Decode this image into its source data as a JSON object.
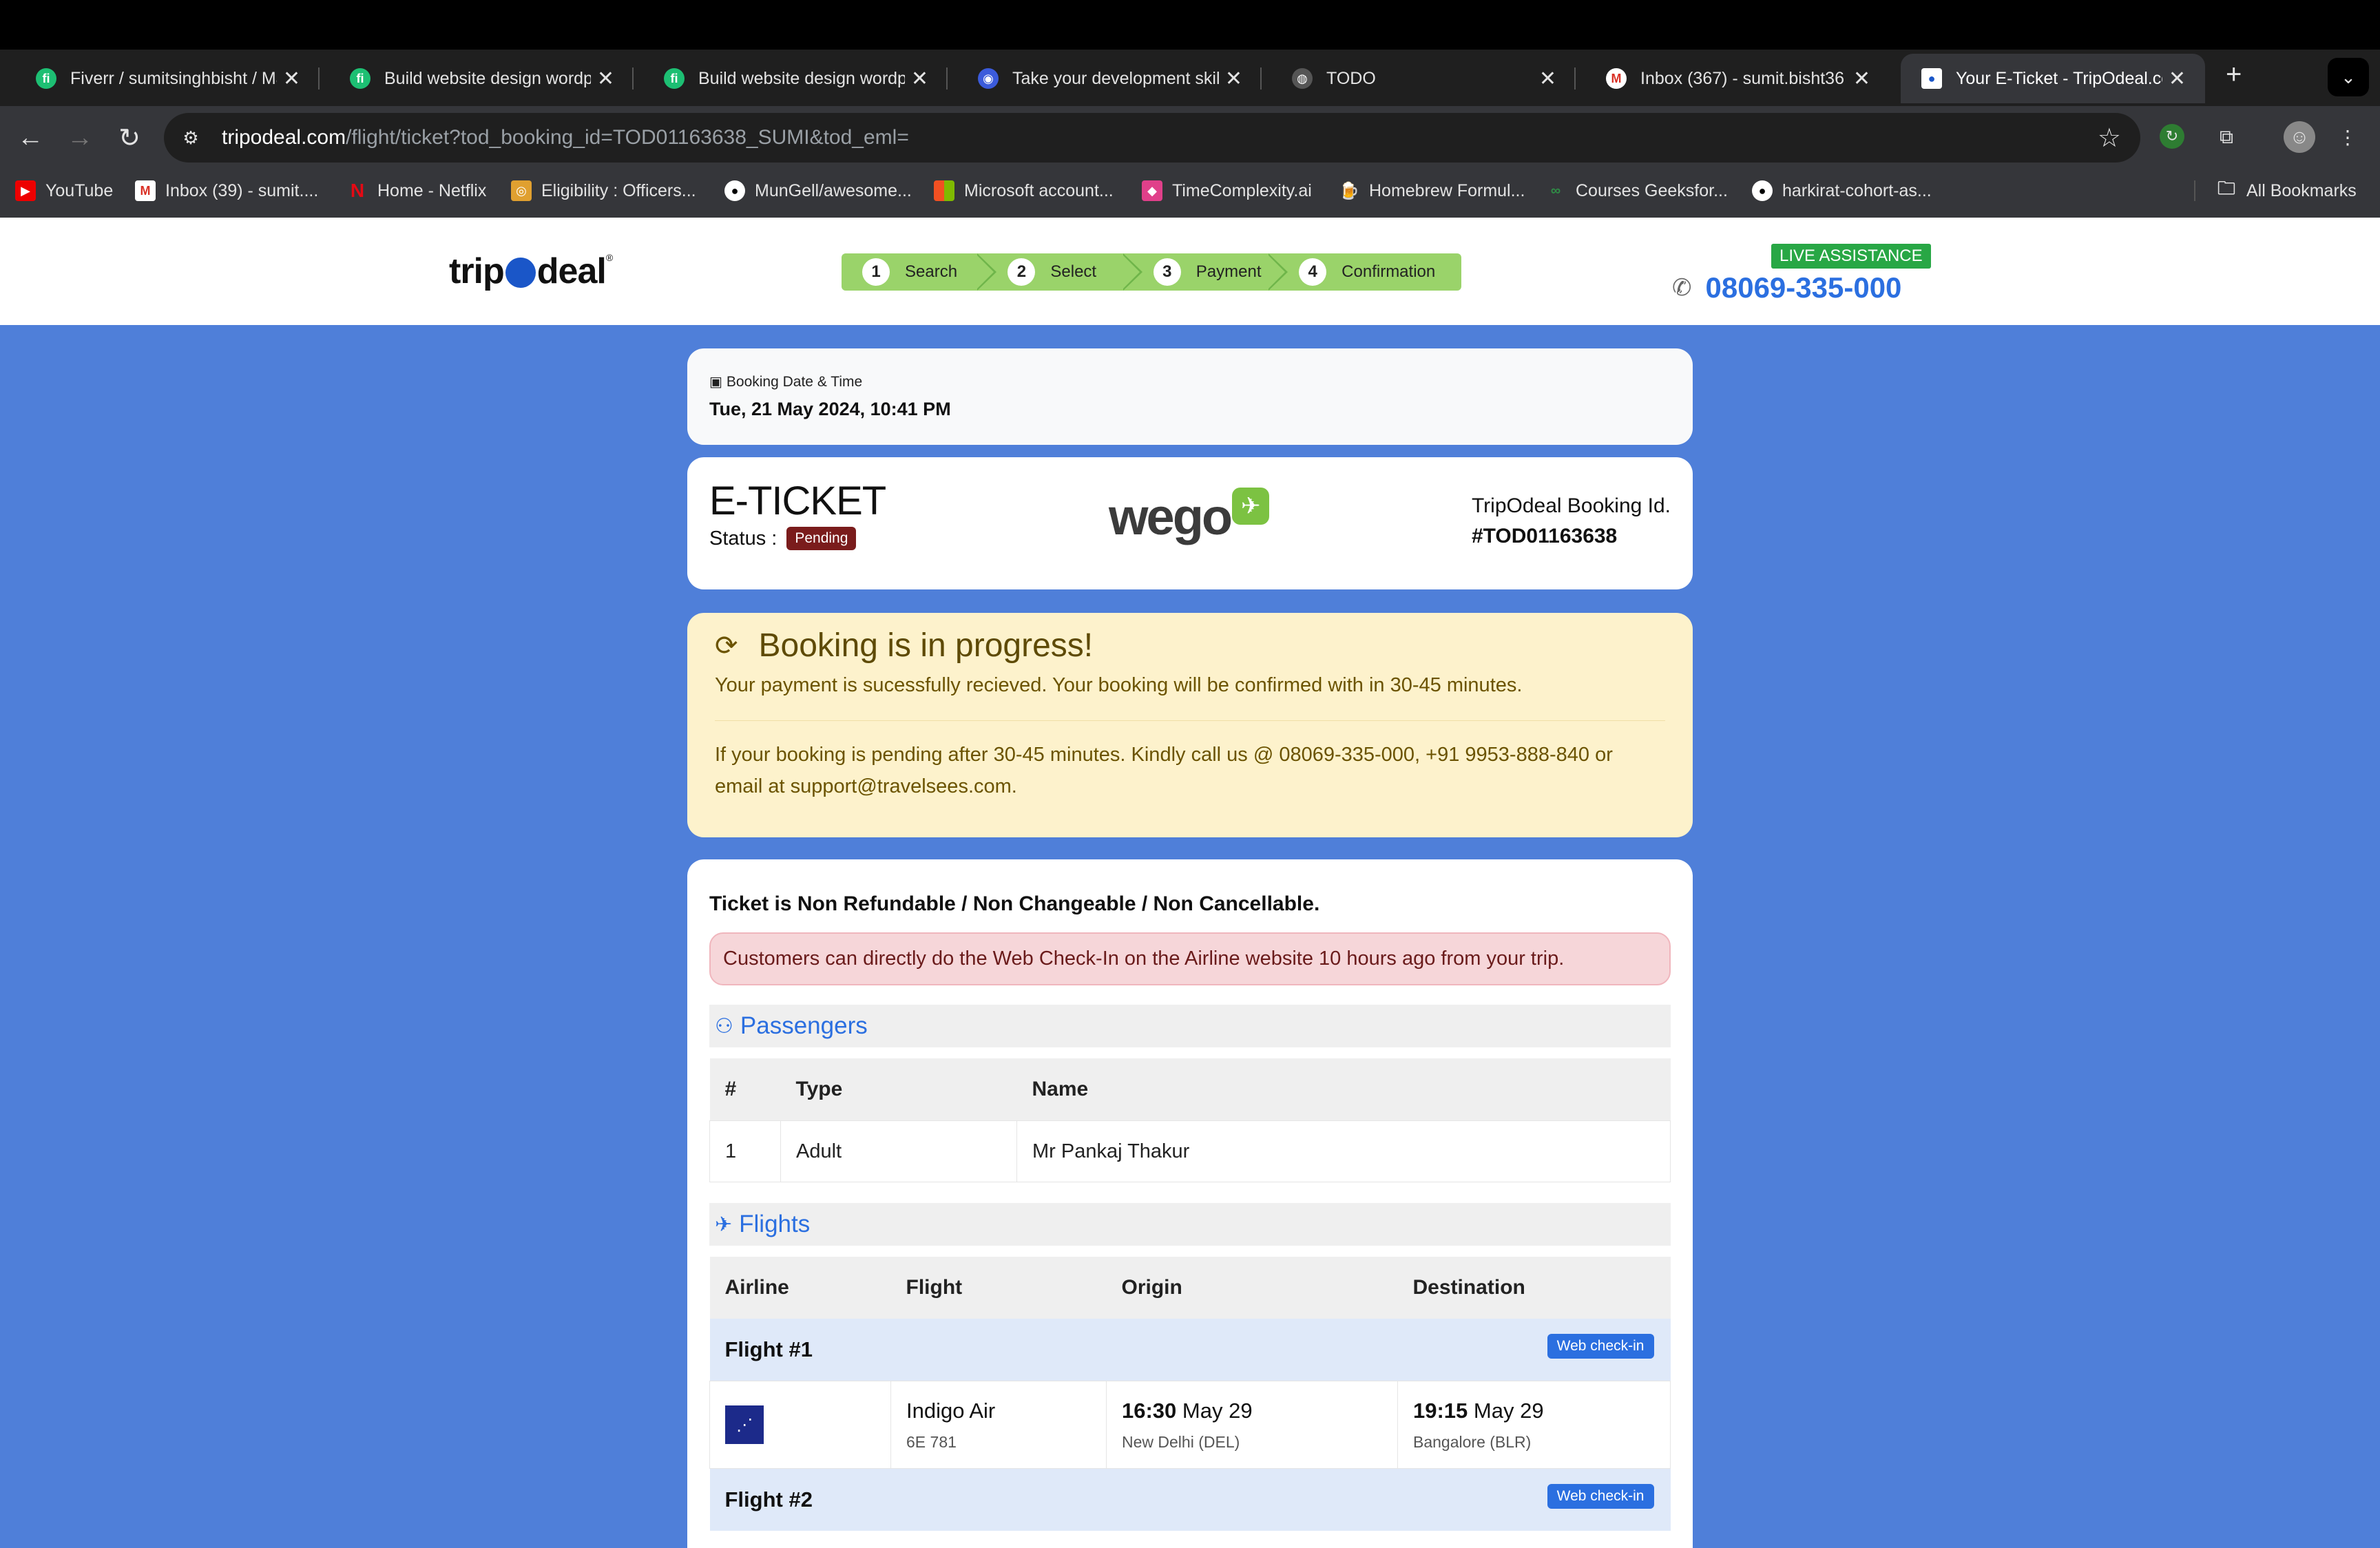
{
  "browser": {
    "tabs": [
      {
        "label": "Fiverr / sumitsinghbisht / Ma",
        "icon": "fiverr-icon"
      },
      {
        "label": "Build website design wordpr",
        "icon": "fiverr-icon"
      },
      {
        "label": "Build website design wordpr",
        "icon": "fiverr-icon"
      },
      {
        "label": "Take your development skill",
        "icon": "globe-icon"
      },
      {
        "label": "TODO",
        "icon": "globe-icon"
      },
      {
        "label": "Inbox (367) - sumit.bisht36",
        "icon": "gmail-icon"
      },
      {
        "label": "Your E-Ticket - TripOdeal.co",
        "icon": "tripodeal-icon"
      }
    ],
    "url_host": "tripodeal.com",
    "url_path": "/flight/ticket?tod_booking_id=TOD01163638_SUMI&tod_eml=",
    "bookmarks": [
      "YouTube",
      "Inbox (39) - sumit....",
      "Home - Netflix",
      "Eligibility : Officers...",
      "MunGell/awesome...",
      "Microsoft account...",
      "TimeComplexity.ai",
      "Homebrew Formul...",
      "Courses Geeksfor...",
      "harkirat-cohort-as..."
    ],
    "all_bookmarks": "All Bookmarks"
  },
  "header": {
    "logo_left": "trip",
    "logo_right": "deal",
    "logo_reg": "®",
    "steps": [
      {
        "num": "1",
        "label": "Search"
      },
      {
        "num": "2",
        "label": "Select"
      },
      {
        "num": "3",
        "label": "Payment"
      },
      {
        "num": "4",
        "label": "Confirmation"
      }
    ],
    "live_assistance": "LIVE ASSISTANCE",
    "phone": "08069-335-000"
  },
  "booking_time": {
    "label": "Booking Date & Time",
    "value": "Tue, 21 May 2024, 10:41 PM"
  },
  "ticket": {
    "title": "E-TICKET",
    "status_label": "Status :",
    "status": "Pending",
    "partner_logo": "wego",
    "booking_id_label": "TripOdeal Booking Id.",
    "booking_id": "#TOD01163638"
  },
  "progress_alert": {
    "heading": "Booking is in progress!",
    "line1": "Your payment is sucessfully recieved. Your booking will be confirmed with in 30-45 minutes.",
    "line2": "If your booking is pending after 30-45 minutes. Kindly call us @ 08069-335-000, +91 9953-888-840 or email at support@travelsees.com."
  },
  "details": {
    "non_refundable": "Ticket is Non Refundable / Non Changeable / Non Cancellable.",
    "checkin_note": "Customers can directly do the Web Check-In on the Airline website 10 hours ago from your trip.",
    "passengers_title": "Passengers",
    "passenger_headers": [
      "#",
      "Type",
      "Name"
    ],
    "passengers": [
      {
        "num": "1",
        "type": "Adult",
        "name": "Mr Pankaj Thakur"
      }
    ],
    "flights_title": "Flights",
    "flight_headers": [
      "Airline",
      "Flight",
      "Origin",
      "Destination"
    ],
    "web_checkin_label": "Web check-in",
    "flights": [
      {
        "label": "Flight #1",
        "airline": "Indigo Air",
        "flight_no": "6E 781",
        "origin_time": "16:30",
        "origin_date": "May 29",
        "origin_place": "New Delhi (DEL)",
        "dest_time": "19:15",
        "dest_date": "May 29",
        "dest_place": "Bangalore (BLR)"
      },
      {
        "label": "Flight #2"
      }
    ]
  }
}
